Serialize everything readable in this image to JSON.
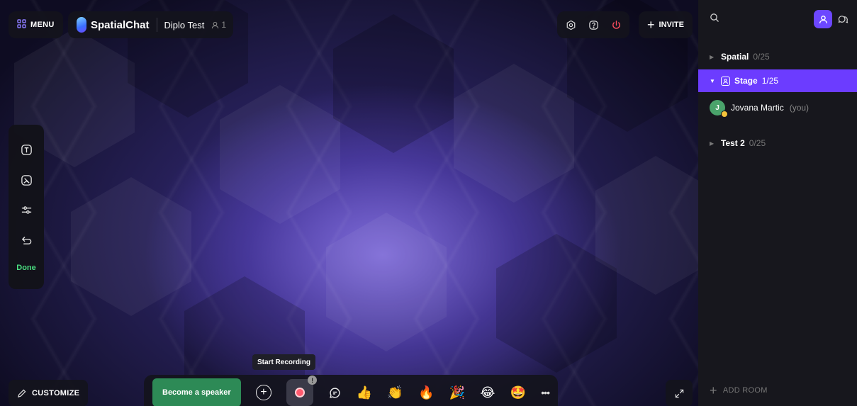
{
  "header": {
    "menu_label": "MENU",
    "brand": "SpatialChat",
    "room_name": "Diplo Test",
    "user_count": "1",
    "invite_label": "INVITE"
  },
  "toolbar": {
    "done_label": "Done"
  },
  "bottom": {
    "customize_label": "CUSTOMIZE",
    "speaker_label": "Become a speaker",
    "tooltip": "Start Recording",
    "reactions": [
      "👍",
      "👏",
      "🔥",
      "🎉",
      "😂",
      "🤩"
    ],
    "more_label": "•••"
  },
  "sidebar": {
    "rooms": [
      {
        "name": "Spatial",
        "count": "0/25"
      },
      {
        "name": "Stage",
        "count": "1/25"
      },
      {
        "name": "Test 2",
        "count": "0/25"
      }
    ],
    "member": {
      "initial": "J",
      "name": "Jovana Martic",
      "tag": "(you)"
    },
    "add_room_label": "ADD ROOM"
  },
  "colors": {
    "accent": "#6c47ff",
    "speaker_green": "#2d8a56",
    "done_green": "#4ade80",
    "power_red": "#ff4d5e"
  },
  "icons": [
    "menu-grid-icon",
    "user-icon",
    "settings-icon",
    "help-icon",
    "power-icon",
    "plus-icon",
    "text-icon",
    "image-icon",
    "sliders-icon",
    "undo-icon",
    "pencil-icon",
    "add-circle-icon",
    "record-icon",
    "chat-icon",
    "expand-icon",
    "search-icon",
    "people-icon",
    "chat-bubble-icon"
  ]
}
